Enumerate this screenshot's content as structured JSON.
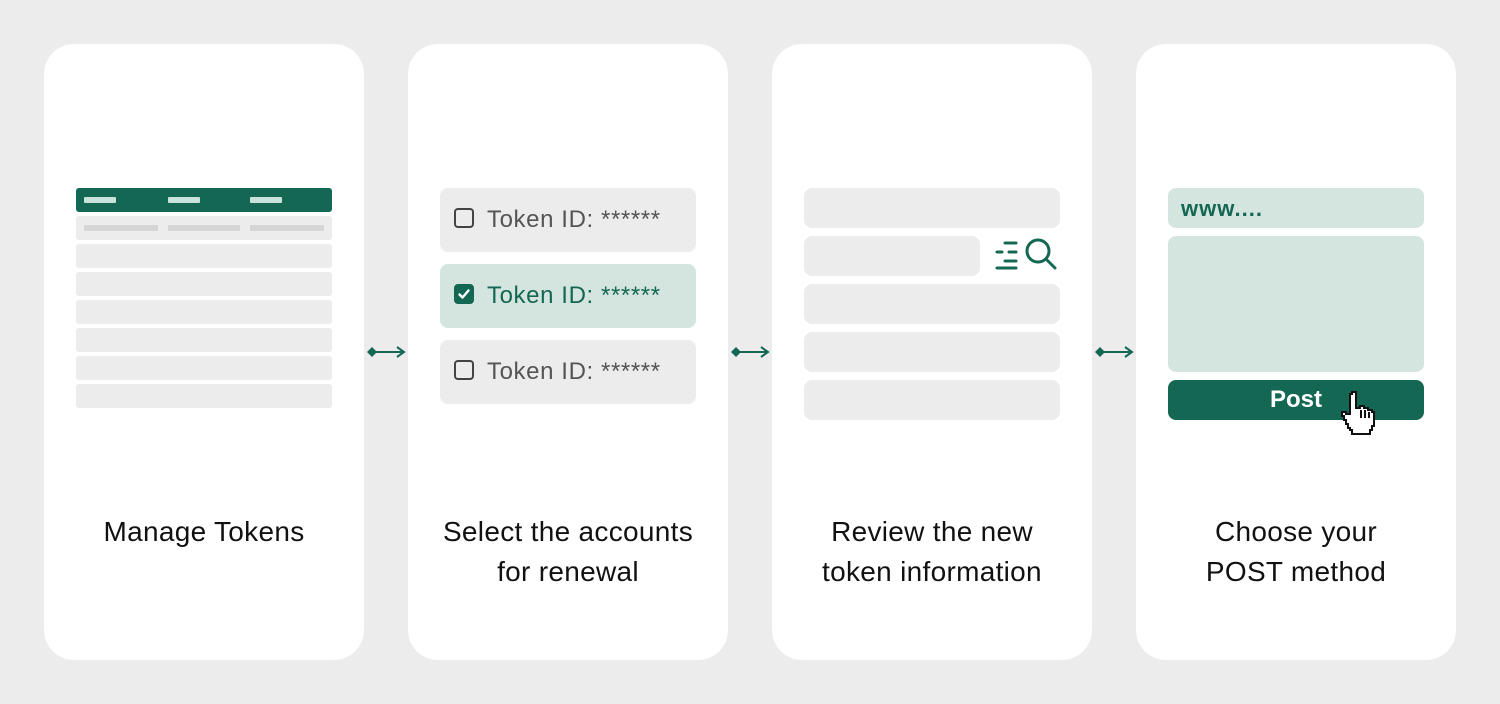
{
  "colors": {
    "background": "#ececec",
    "card": "#ffffff",
    "accent": "#146853",
    "accent_light": "#d4e5df",
    "placeholder": "#ececec"
  },
  "steps": [
    {
      "caption_lines": [
        "Manage Tokens"
      ]
    },
    {
      "caption_lines": [
        "Select the accounts",
        "for renewal"
      ],
      "tokens": [
        {
          "label": "Token ID: ******",
          "checked": false
        },
        {
          "label": "Token ID: ******",
          "checked": true
        },
        {
          "label": "Token ID: ******",
          "checked": false
        }
      ]
    },
    {
      "caption_lines": [
        "Review the new",
        "token information"
      ],
      "icon": "search-list-icon"
    },
    {
      "caption_lines": [
        "Choose your",
        "POST method"
      ],
      "url_text": "www....",
      "button_label": "Post",
      "icon": "hand-cursor-icon"
    }
  ]
}
